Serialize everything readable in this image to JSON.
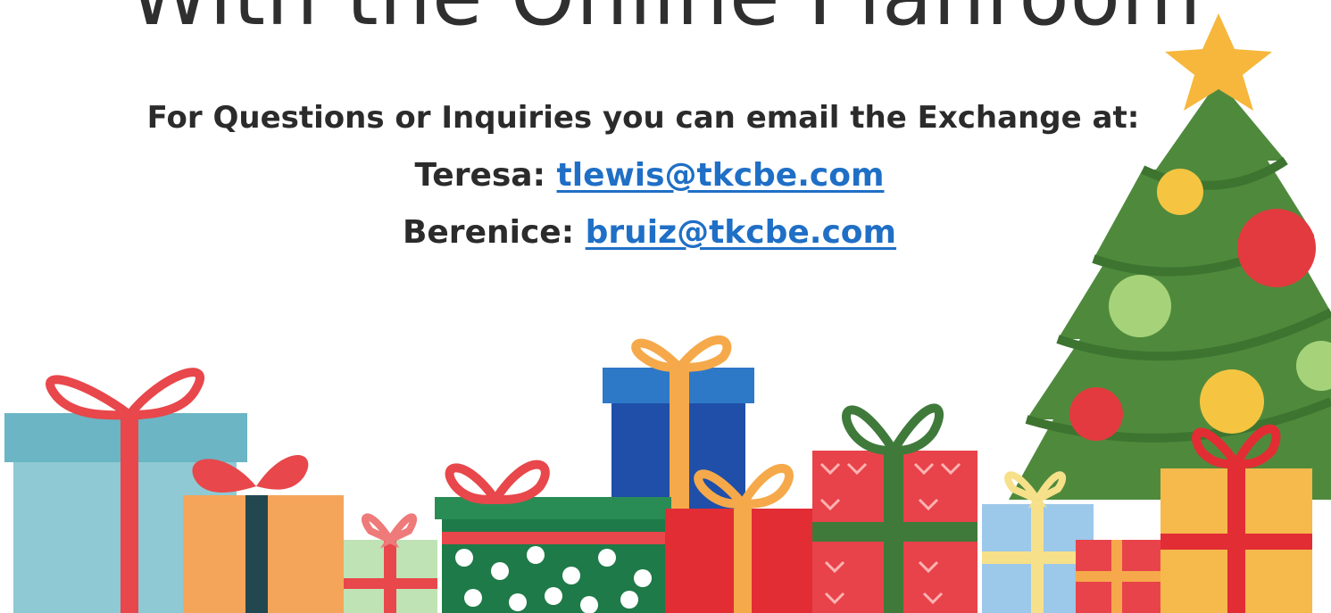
{
  "title": "With the Online Planroom",
  "questions_line": "For Questions or Inquiries you can email the Exchange at:",
  "contacts": [
    {
      "name": "Teresa:",
      "email": "tlewis@tkcbe.com"
    },
    {
      "name": "Berenice:",
      "email": "bruiz@tkcbe.com"
    }
  ],
  "colors": {
    "text": "#2b2b2b",
    "link": "#1f6fc6",
    "tree_green": "#4f8a3c",
    "star": "#f6b73c",
    "ribbon_red": "#e0343a"
  }
}
